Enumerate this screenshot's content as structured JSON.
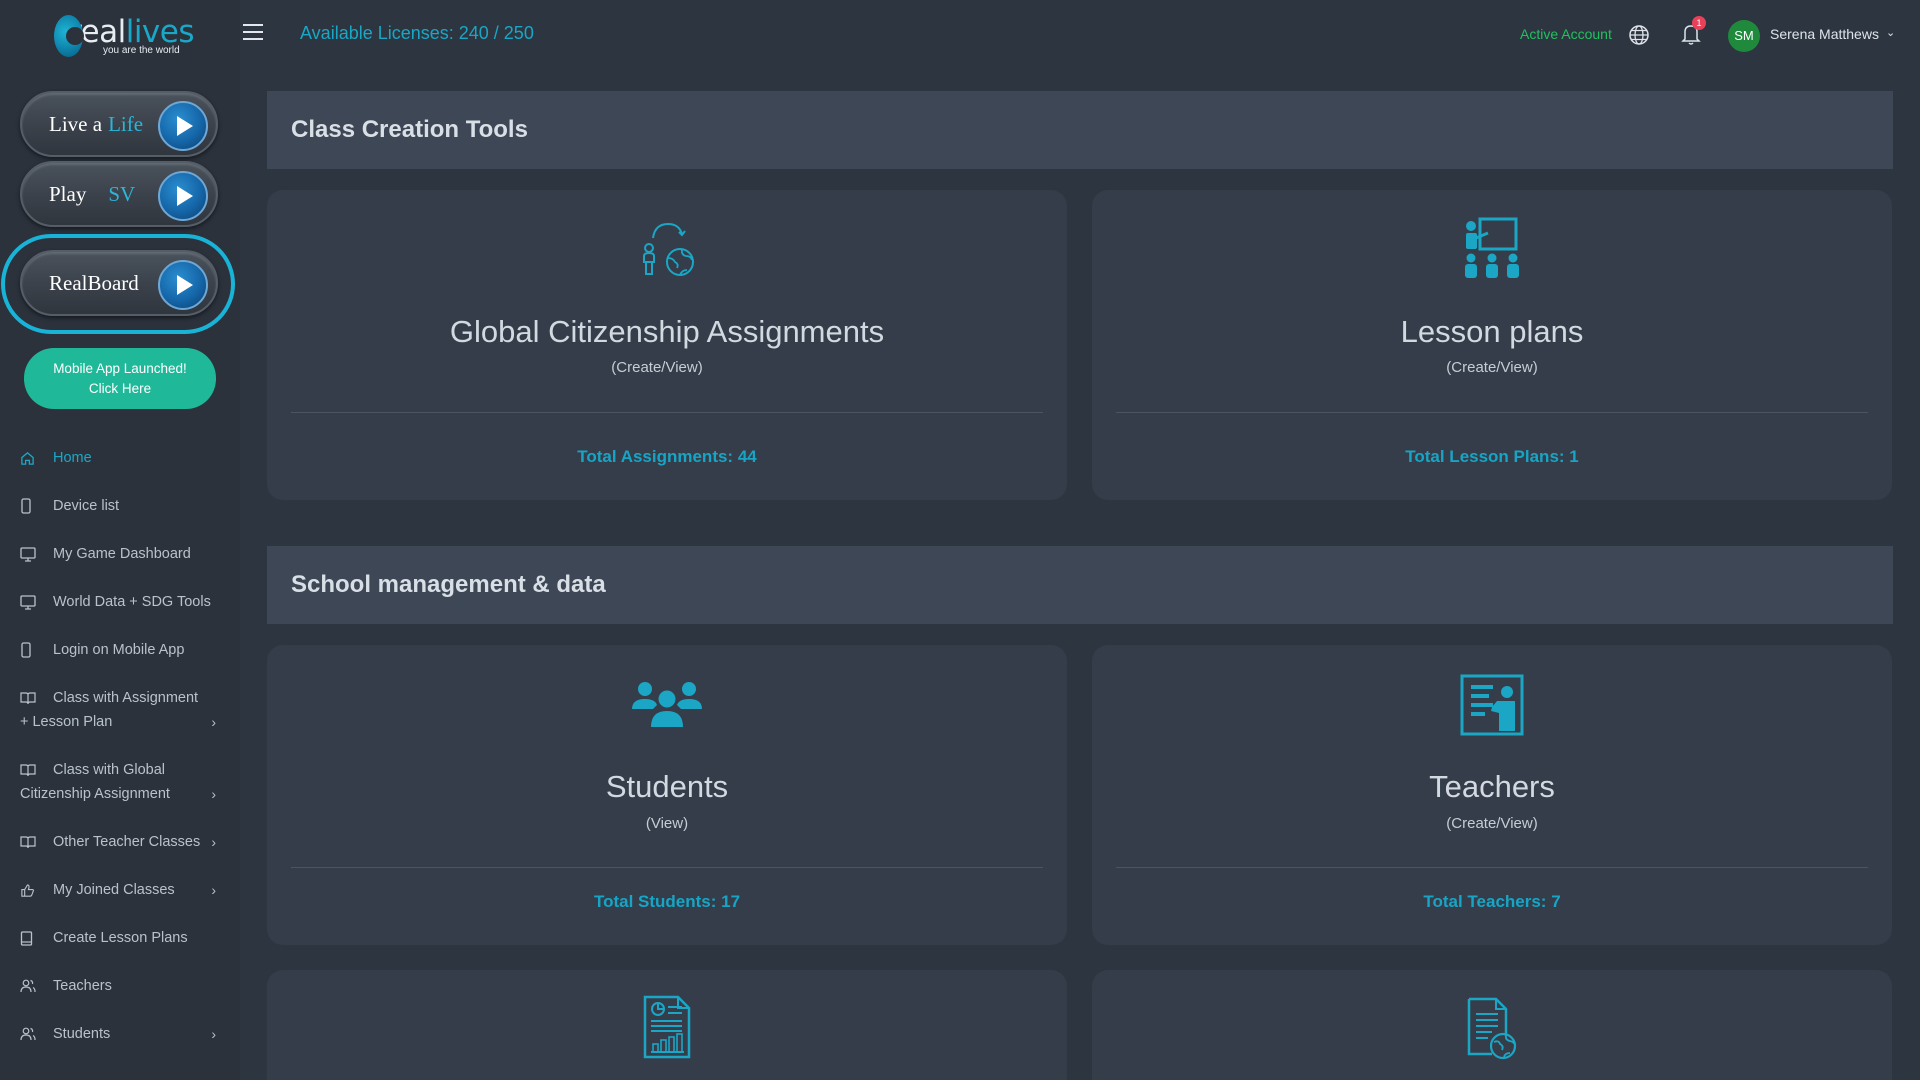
{
  "brand": {
    "logo_word_a": "real",
    "logo_word_b": "lives",
    "tagline": "you are the world",
    "accent_color": "#1aa8c8"
  },
  "sidebar": {
    "game_buttons": [
      {
        "label_a": "Live a",
        "label_b": "Life"
      },
      {
        "label_a": "Play",
        "label_b": "SV"
      },
      {
        "label_a": "RealBoard",
        "label_b": ""
      }
    ],
    "mobile_promo": {
      "line1": "Mobile App Launched!",
      "line2": "Click Here"
    },
    "nav": [
      {
        "label": "Home",
        "icon": "home-icon",
        "active": true
      },
      {
        "label": "Device list",
        "icon": "phone-icon"
      },
      {
        "label": "My Game Dashboard",
        "icon": "monitor-icon"
      },
      {
        "label": "World Data + SDG Tools",
        "icon": "monitor-icon"
      },
      {
        "label": "Login on Mobile App",
        "icon": "phone-icon"
      },
      {
        "label_line1": "Class with Assignment",
        "label_line2": "+ Lesson Plan",
        "icon": "book-icon",
        "has_chevron": true
      },
      {
        "label_line1": "Class with Global",
        "label_line2": "Citizenship Assignment",
        "icon": "book-icon",
        "has_chevron": true
      },
      {
        "label": "Other Teacher Classes",
        "icon": "book-icon",
        "has_chevron": true
      },
      {
        "label": "My Joined Classes",
        "icon": "thumbs-up-icon",
        "has_chevron": true
      },
      {
        "label": "Create Lesson Plans",
        "icon": "document-icon"
      },
      {
        "label": "Teachers",
        "icon": "users-icon"
      },
      {
        "label": "Students",
        "icon": "users-icon",
        "has_chevron": true
      }
    ]
  },
  "topbar": {
    "licenses": "Available Licenses: 240 / 250",
    "account_status": "Active Account",
    "notification_count": "1",
    "user_initials": "SM",
    "user_name": "Serena Matthews"
  },
  "sections": [
    {
      "title": "Class Creation Tools"
    },
    {
      "title": "School management & data"
    }
  ],
  "cards": [
    {
      "title": "Global Citizenship Assignments",
      "subtitle": "(Create/View)",
      "total": "Total Assignments: 44",
      "icon": "global-citizenship-icon"
    },
    {
      "title": "Lesson plans",
      "subtitle": "(Create/View)",
      "total": "Total Lesson Plans: 1",
      "icon": "classroom-icon"
    },
    {
      "title": "Students",
      "subtitle": "(View)",
      "total": "Total Students: 17",
      "icon": "students-icon"
    },
    {
      "title": "Teachers",
      "subtitle": "(Create/View)",
      "total": "Total Teachers: 7",
      "icon": "teacher-icon"
    },
    {
      "title": "",
      "subtitle": "",
      "total": "",
      "icon": "report-icon"
    },
    {
      "title": "",
      "subtitle": "",
      "total": "",
      "icon": "world-document-icon"
    }
  ]
}
